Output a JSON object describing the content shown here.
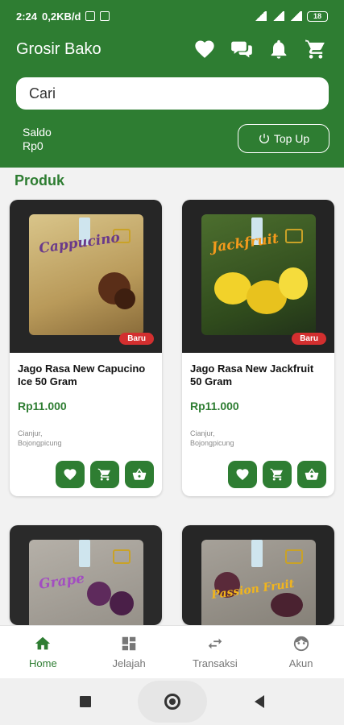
{
  "status_bar": {
    "time": "2:24",
    "network_speed": "0,2KB/d",
    "battery": "18"
  },
  "header": {
    "title": "Grosir Bako",
    "icons": [
      "heart-icon",
      "chat-icon",
      "bell-icon",
      "cart-icon"
    ]
  },
  "search": {
    "placeholder": "Cari"
  },
  "wallet": {
    "label": "Saldo",
    "balance": "Rp0",
    "topup_label": "Top Up"
  },
  "section": {
    "title": "Produk"
  },
  "products": [
    {
      "name": "Jago Rasa New Capucino Ice 50 Gram",
      "price": "Rp11.000",
      "location_line1": "Cianjur,",
      "location_line2": "Bojongpicung",
      "badge": "Baru",
      "pack_text": "Cappucino"
    },
    {
      "name": "Jago Rasa New Jackfruit 50 Gram",
      "price": "Rp11.000",
      "location_line1": "Cianjur,",
      "location_line2": "Bojongpicung",
      "badge": "Baru",
      "pack_text": "Jackfruit"
    },
    {
      "pack_text": "Grape"
    },
    {
      "pack_text": "Passion Fruit"
    }
  ],
  "bottom_nav": [
    {
      "label": "Home",
      "icon": "home-icon",
      "active": true
    },
    {
      "label": "Jelajah",
      "icon": "explore-icon",
      "active": false
    },
    {
      "label": "Transaksi",
      "icon": "transaction-icon",
      "active": false
    },
    {
      "label": "Akun",
      "icon": "account-icon",
      "active": false
    }
  ],
  "colors": {
    "primary": "#2e7d32",
    "badge": "#d32f2f"
  }
}
